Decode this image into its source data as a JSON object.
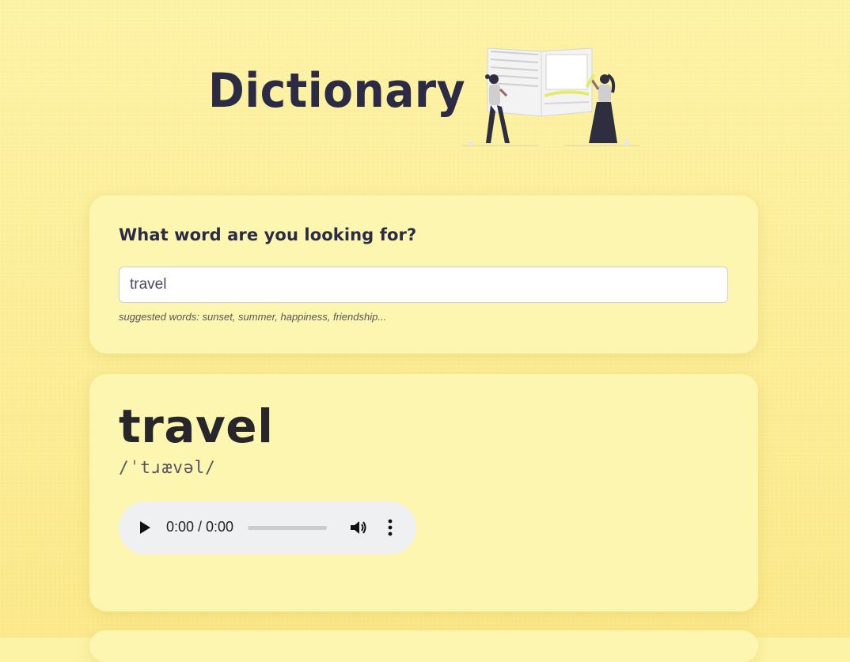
{
  "header": {
    "title": "Dictionary",
    "illustration": "two-people-reading-open-book"
  },
  "search": {
    "prompt": "What word are you looking for?",
    "value": "travel",
    "hint": "suggested words: sunset, summer, happiness, friendship..."
  },
  "result": {
    "word": "travel",
    "phonetic": "/ˈtɹævəl/",
    "audio": {
      "time": "0:00 / 0:00",
      "progress": 0,
      "icons": [
        "play-icon",
        "volume-icon",
        "more-vertical-icon"
      ]
    }
  },
  "colors": {
    "background": "#fbe98a",
    "card": "#fcf6b1",
    "text_dark": "#2b2b45",
    "accent": "#e3ec6a"
  }
}
